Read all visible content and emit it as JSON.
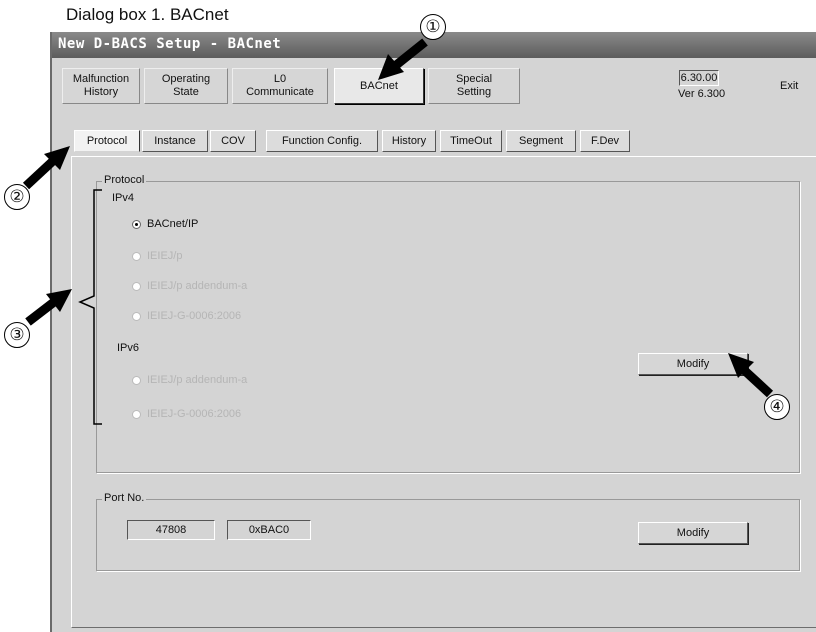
{
  "caption": "Dialog box 1. BACnet",
  "window": {
    "title": "New D-BACS Setup - BACnet"
  },
  "top_buttons": [
    {
      "label": "Malfunction\nHistory"
    },
    {
      "label": "Operating\nState"
    },
    {
      "label": "L0\nCommunicate"
    },
    {
      "label": "BACnet"
    },
    {
      "label": "Special\nSetting"
    }
  ],
  "version": {
    "box": "6.30.00",
    "label": "Ver 6.300"
  },
  "exit_label": "Exit",
  "tabs": [
    "Protocol",
    "Instance",
    "COV",
    "Function Config.",
    "History",
    "TimeOut",
    "Segment",
    "F.Dev"
  ],
  "protocol": {
    "group_title": "Protocol",
    "ipv4_label": "IPv4",
    "ipv4_options": [
      {
        "label": "BACnet/IP",
        "selected": true,
        "enabled": true
      },
      {
        "label": "IEIEJ/p",
        "selected": false,
        "enabled": false
      },
      {
        "label": "IEIEJ/p addendum-a",
        "selected": false,
        "enabled": false
      },
      {
        "label": "IEIEJ-G-0006:2006",
        "selected": false,
        "enabled": false
      }
    ],
    "ipv6_label": "IPv6",
    "ipv6_options": [
      {
        "label": "IEIEJ/p addendum-a",
        "selected": false,
        "enabled": false
      },
      {
        "label": "IEIEJ-G-0006:2006",
        "selected": false,
        "enabled": false
      }
    ],
    "modify_label": "Modify"
  },
  "port": {
    "group_title": "Port No.",
    "decimal": "47808",
    "hex": "0xBAC0",
    "modify_label": "Modify"
  },
  "callouts": [
    "①",
    "②",
    "③",
    "④"
  ]
}
